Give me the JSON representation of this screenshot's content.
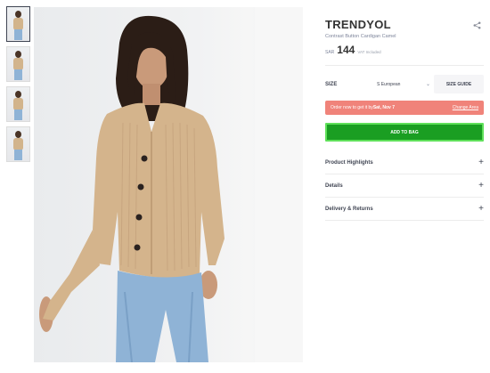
{
  "thumbnails": [
    {
      "alt": "model-front-thumb",
      "active": true
    },
    {
      "alt": "model-side-thumb",
      "active": false
    },
    {
      "alt": "model-seated-thumb",
      "active": false
    },
    {
      "alt": "model-closeup-thumb",
      "active": false
    }
  ],
  "product": {
    "brand": "TRENDYOL",
    "name": "Contrast Button Cardigan Camel",
    "currency": "SAR",
    "price": "144",
    "vat_note": "VAT Included"
  },
  "size": {
    "label": "SIZE",
    "selected": "S European",
    "guide_label": "SIZE GUIDE"
  },
  "delivery": {
    "prefix": "Order now to get it by ",
    "date": "Sat, Nov 7",
    "change_label": "Change Area"
  },
  "cta": {
    "add_to_bag": "ADD TO BAG"
  },
  "accordion": [
    {
      "label": "Product Highlights",
      "icon": "+"
    },
    {
      "label": "Details",
      "icon": "+"
    },
    {
      "label": "Delivery & Returns",
      "icon": "+"
    }
  ],
  "colors": {
    "cta": "#1a9e22",
    "cta_outline": "#5fe05a",
    "delivery_banner": "#f0837a",
    "text": "#404553"
  }
}
